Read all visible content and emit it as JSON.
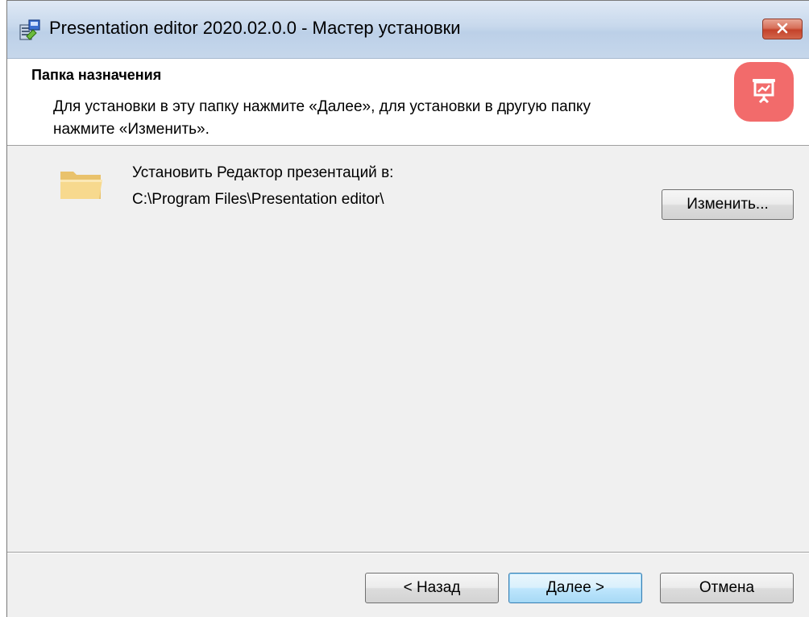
{
  "window": {
    "title": "Presentation editor 2020.02.0.0 - Мастер установки",
    "close_symbol": "✕"
  },
  "header": {
    "title": "Папка назначения",
    "description": "Для установки в эту папку нажмите «Далее», для установки в другую папку нажмите «Изменить».",
    "logo_color": "#f26b6b"
  },
  "content": {
    "install_label": "Установить Редактор презентаций в:",
    "install_path": "C:\\Program Files\\Presentation editor\\",
    "change_button": "Изменить..."
  },
  "footer": {
    "back_button": "< Назад",
    "next_button": "Далее >",
    "cancel_button": "Отмена"
  },
  "icons": {
    "title": "installer-icon",
    "folder": "folder-icon",
    "logo": "presentation-icon",
    "close": "close-icon"
  }
}
